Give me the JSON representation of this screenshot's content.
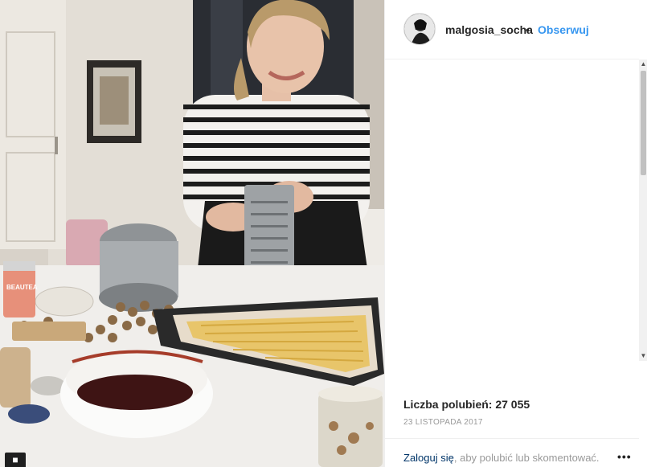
{
  "post": {
    "username": "malgosia_socha",
    "separator": "•",
    "follow_label": "Obserwuj",
    "likes_text": "Liczba polubień: 27 055",
    "date_text": "23 LISTOPADA 2017",
    "login_link": "Zaloguj się",
    "login_rest": ", aby polubić lub skomentować.",
    "more_label": "•••"
  },
  "photo": {
    "jar_label": "BEAUTEA"
  },
  "icons": {
    "avatar": "profile-avatar",
    "more": "more-options-icon",
    "corner": "person-icon"
  }
}
